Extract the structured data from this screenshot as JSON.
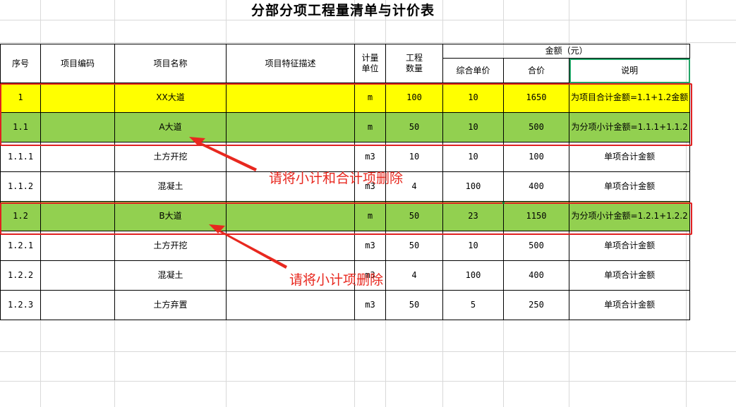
{
  "title": "分部分项工程量清单与计价表",
  "header": {
    "seq": "序号",
    "code": "项目编码",
    "name": "项目名称",
    "feature": "项目特征描述",
    "unit_l1": "计量",
    "unit_l2": "单位",
    "qty_l1": "工程",
    "qty_l2": "数量",
    "amount_group": "金额（元）",
    "unit_price": "综合单价",
    "total": "合价",
    "note": "说明"
  },
  "rows": [
    {
      "seq": "1",
      "code": "",
      "name": "XX大道",
      "feature": "",
      "unit": "m",
      "qty": "100",
      "price": "10",
      "total": "1650",
      "note": "为项目合计金额=1.1+1.2金额",
      "style": "yellow"
    },
    {
      "seq": "1.1",
      "code": "",
      "name": "A大道",
      "feature": "",
      "unit": "m",
      "qty": "50",
      "price": "10",
      "total": "500",
      "note": "为分项小计金额=1.1.1+1.1.2",
      "style": "green"
    },
    {
      "seq": "1.1.1",
      "code": "",
      "name": "土方开挖",
      "feature": "",
      "unit": "m3",
      "qty": "10",
      "price": "10",
      "total": "100",
      "note": "单项合计金额",
      "style": ""
    },
    {
      "seq": "1.1.2",
      "code": "",
      "name": "混凝土",
      "feature": "",
      "unit": "m3",
      "qty": "4",
      "price": "100",
      "total": "400",
      "note": "单项合计金额",
      "style": ""
    },
    {
      "seq": "1.2",
      "code": "",
      "name": "B大道",
      "feature": "",
      "unit": "m",
      "qty": "50",
      "price": "23",
      "total": "1150",
      "note": "为分项小计金额=1.2.1+1.2.2",
      "style": "green"
    },
    {
      "seq": "1.2.1",
      "code": "",
      "name": "土方开挖",
      "feature": "",
      "unit": "m3",
      "qty": "50",
      "price": "10",
      "total": "500",
      "note": "单项合计金额",
      "style": ""
    },
    {
      "seq": "1.2.2",
      "code": "",
      "name": "混凝土",
      "feature": "",
      "unit": "m3",
      "qty": "4",
      "price": "100",
      "total": "400",
      "note": "单项合计金额",
      "style": ""
    },
    {
      "seq": "1.2.3",
      "code": "",
      "name": "土方弃置",
      "feature": "",
      "unit": "m3",
      "qty": "50",
      "price": "5",
      "total": "250",
      "note": "单项合计金额",
      "style": ""
    }
  ],
  "annotations": {
    "note1": "请将小计和合计项删除",
    "note2": "请将小计项删除"
  },
  "colors": {
    "yellow_fill": "#ffff00",
    "green_fill": "#92d050",
    "annotation_red": "#e8281f",
    "selection_green": "#21a366"
  }
}
